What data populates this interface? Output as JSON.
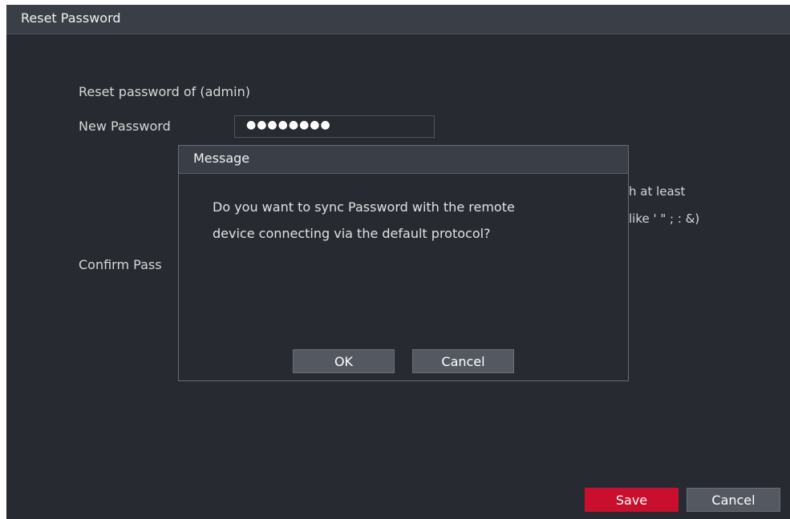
{
  "window": {
    "title": "Reset Password"
  },
  "form": {
    "reset_label": "Reset password of (admin)",
    "new_password_label": "New Password",
    "new_password_value": "●●●●●●●●",
    "confirm_password_label_visible": "Confirm Pass",
    "hint_line1_visible": "h at least",
    "hint_line2_visible": "like ' \" ; : &)"
  },
  "footer": {
    "save_label": "Save",
    "cancel_label": "Cancel"
  },
  "dialog": {
    "title": "Message",
    "message_line1": "Do you want to sync Password with the remote",
    "message_line2": "device connecting via the default protocol?",
    "ok_label": "OK",
    "cancel_label": "Cancel"
  },
  "colors": {
    "background": "#272a31",
    "titlebar": "#3a3e47",
    "save_button": "#c8102e",
    "secondary_button": "#545861"
  }
}
